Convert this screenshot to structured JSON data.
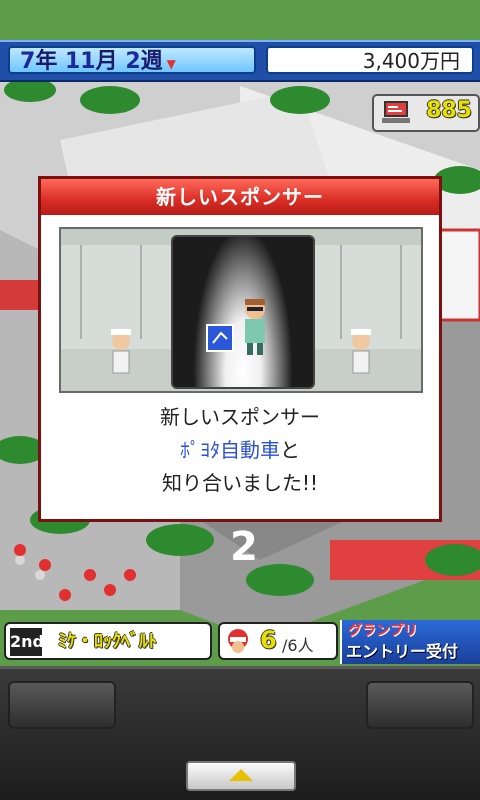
{
  "status": {
    "year": "7",
    "year_unit": "年",
    "month": "11",
    "month_unit": "月",
    "week": "2",
    "week_unit": "週",
    "money": "3,400万円",
    "research_points": "885"
  },
  "dialog": {
    "title": "新しいスポンサー",
    "line1": "新しいスポンサー",
    "sponsor_name": "ﾎﾟﾖﾀ自動車",
    "line2_suffix": "と",
    "line3": "知り合いました!!"
  },
  "info": {
    "rank": "2nd",
    "driver_name": "ﾐｹ・ﾛｯｸﾍﾞﾙﾄ",
    "driver_count": "6",
    "driver_total": "/6人",
    "grandprix_line1": "グランプリ",
    "grandprix_line2": "エントリー受付中!"
  }
}
